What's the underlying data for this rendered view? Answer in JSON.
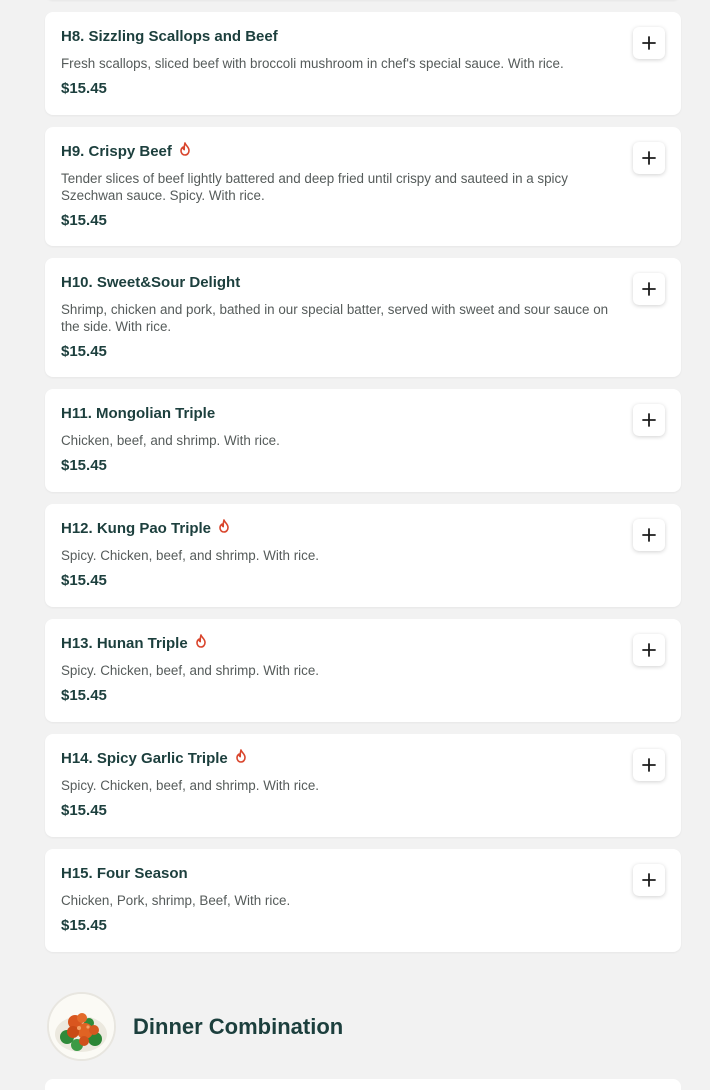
{
  "menu": {
    "items": [
      {
        "name": "H8. Sizzling Scallops and Beef",
        "spicy": false,
        "description": "Fresh scallops, sliced beef with broccoli mushroom in chef's special sauce. With rice.",
        "price": "$15.45"
      },
      {
        "name": "H9. Crispy Beef",
        "spicy": true,
        "description": "Tender slices of beef lightly battered and deep fried until crispy and sauteed in a spicy Szechwan sauce. Spicy. With rice.",
        "price": "$15.45"
      },
      {
        "name": "H10. Sweet&Sour Delight",
        "spicy": false,
        "description": "Shrimp, chicken and pork, bathed in our special batter, served with sweet and sour sauce on the side. With rice.",
        "price": "$15.45"
      },
      {
        "name": "H11. Mongolian Triple",
        "spicy": false,
        "description": "Chicken, beef, and shrimp. With rice.",
        "price": "$15.45"
      },
      {
        "name": "H12. Kung Pao Triple",
        "spicy": true,
        "description": "Spicy. Chicken, beef, and shrimp. With rice.",
        "price": "$15.45"
      },
      {
        "name": "H13. Hunan Triple",
        "spicy": true,
        "description": "Spicy. Chicken, beef, and shrimp. With rice.",
        "price": "$15.45"
      },
      {
        "name": "H14. Spicy Garlic Triple",
        "spicy": true,
        "description": "Spicy. Chicken, beef, and shrimp. With rice.",
        "price": "$15.45"
      },
      {
        "name": "H15. Four Season",
        "spicy": false,
        "description": "Chicken, Pork, shrimp, Beef, With rice.",
        "price": "$15.45"
      }
    ]
  },
  "section": {
    "title": "Dinner Combination",
    "avatar_icon": "food-photo-icon"
  },
  "icons": {
    "add": "plus-icon",
    "spicy": "flame-icon"
  },
  "colors": {
    "page_background": "#f2f2f2",
    "card_background": "#ffffff",
    "title_text": "#1c3f3d",
    "description_text": "#555b5a",
    "spicy_icon": "#d9452c"
  }
}
